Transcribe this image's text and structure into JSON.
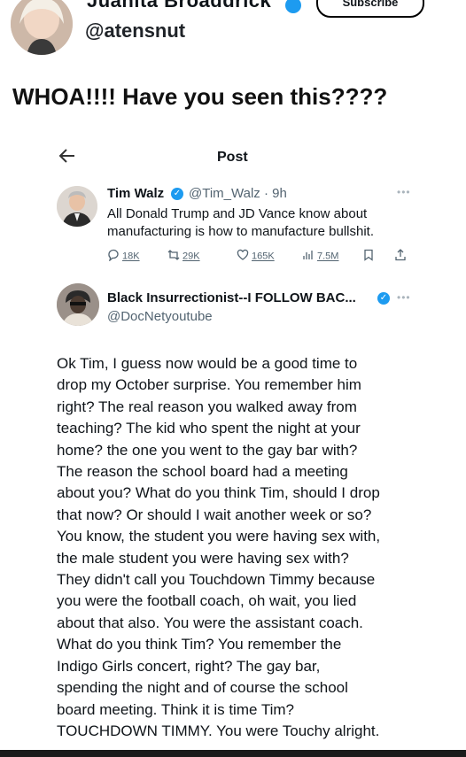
{
  "outer_post": {
    "display_name": "Juanita Broaddrick",
    "handle": "@atensnut",
    "subscribe_label": "Subscribe",
    "text": "WHOA!!!! Have you seen this????"
  },
  "embedded": {
    "page_title": "Post",
    "tweet": {
      "author": "Tim Walz",
      "handle_time": "@Tim_Walz · 9h",
      "text": "All Donald Trump and JD Vance know about manufacturing is how to manufacture bullshit.",
      "stats": {
        "replies": "18K",
        "reposts": "29K",
        "likes": "165K",
        "views": "7.5M"
      }
    },
    "reply": {
      "author": "Black Insurrectionist--I FOLLOW BAC...",
      "handle": "@DocNetyoutube",
      "lines": [
        "Ok Tim, I guess now would be a good time to",
        "drop my October surprise. You remember him",
        "right? The real reason you walked away from",
        "teaching? The kid who spent the night at your",
        "home? the one you went to the gay bar with?",
        "The reason the school board had a meeting",
        "about you? What do you think Tim, should I drop",
        "that now? Or should I wait another week or so?",
        "You know, the student you were having sex with,",
        "the male student you were having sex with?",
        "They didn't call you Touchdown Timmy because",
        "you were the football coach, oh wait, you lied",
        "about that also. You were the assistant coach.",
        "What do you think Tim? You remember the",
        "Indigo Girls concert, right? The gay bar,",
        "spending the night and of course the school",
        "board meeting. Think it is time Tim?",
        "TOUCHDOWN TIMMY. You were Touchy alright."
      ]
    }
  },
  "colors": {
    "verified": "#1d9bf0",
    "muted_text": "#536471"
  }
}
